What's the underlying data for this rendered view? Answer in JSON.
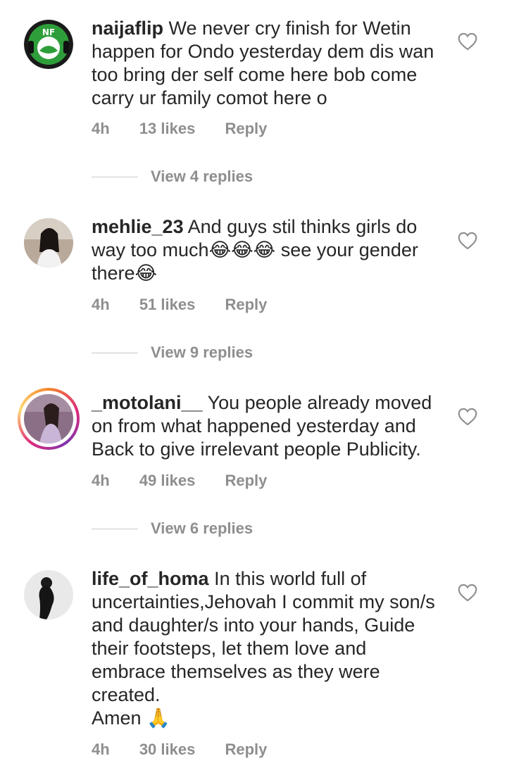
{
  "comments": [
    {
      "username": "naijaflip",
      "text": "We never cry finish for Wetin happen for Ondo yesterday dem dis wan too bring der self come here bob come carry ur family comot here o",
      "time": "4h",
      "likes": "13 likes",
      "reply": "Reply",
      "view_replies": "View 4 replies",
      "avatar_icon": "naijaflip-logo-avatar",
      "avatar_text": "NF"
    },
    {
      "username": "mehlie_23",
      "text": "And guys stil thinks girls do way too much😂😂😂 see your gender there😂",
      "time": "4h",
      "likes": "51 likes",
      "reply": "Reply",
      "view_replies": "View 9 replies",
      "avatar_icon": "user-photo-avatar"
    },
    {
      "username": "_motolani__",
      "text": "You people already moved on from what happened yesterday and Back to give irrelevant people Publicity.",
      "time": "4h",
      "likes": "49 likes",
      "reply": "Reply",
      "view_replies": "View 6 replies",
      "avatar_icon": "user-photo-avatar-story-ring"
    },
    {
      "username": "life_of_homa",
      "text": "In this world full of uncertainties,Jehovah I commit my son/s and daughter/s into your hands, Guide their footsteps, let them love and embrace themselves as they were created.\nAmen 🙏",
      "time": "4h",
      "likes": "30 likes",
      "reply": "Reply",
      "avatar_icon": "user-photo-avatar"
    }
  ],
  "colors": {
    "text": "#262626",
    "meta": "#8e8e8e",
    "line": "#c7c7c7"
  },
  "icons": {
    "like": "heart-outline-icon"
  }
}
